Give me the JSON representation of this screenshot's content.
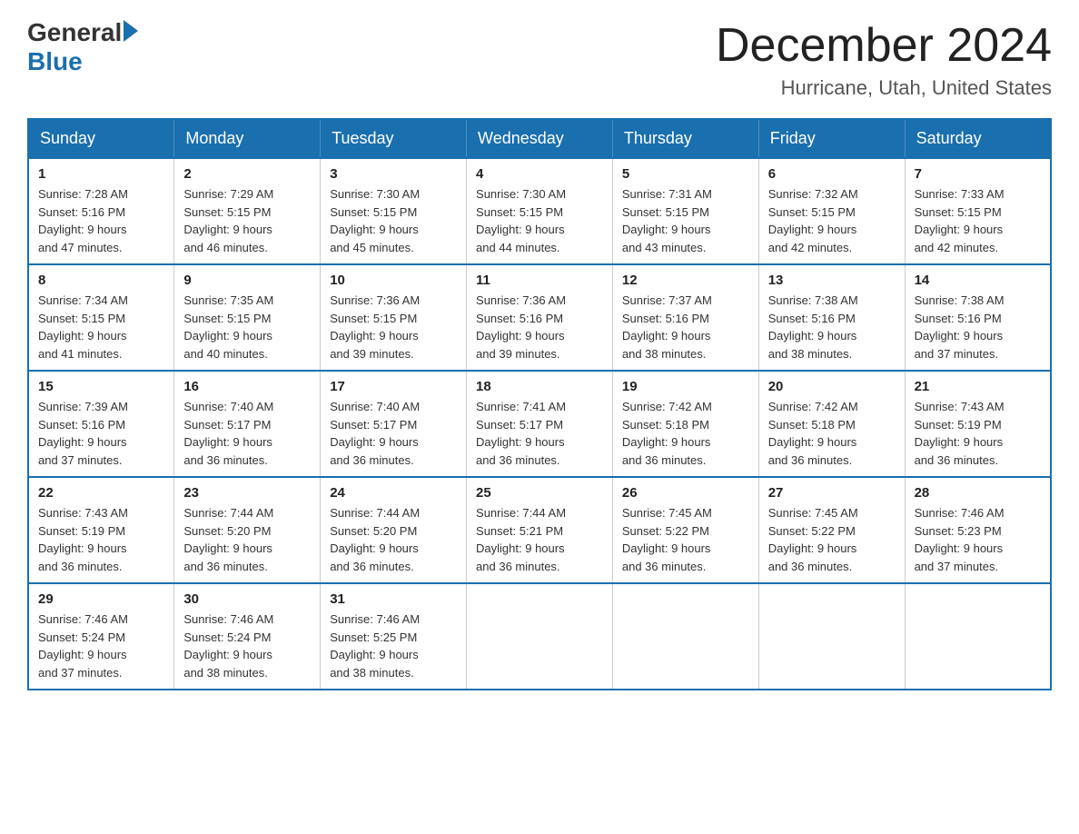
{
  "logo": {
    "general": "General",
    "blue": "Blue"
  },
  "title": "December 2024",
  "location": "Hurricane, Utah, United States",
  "weekdays": [
    "Sunday",
    "Monday",
    "Tuesday",
    "Wednesday",
    "Thursday",
    "Friday",
    "Saturday"
  ],
  "weeks": [
    [
      {
        "day": "1",
        "sunrise": "7:28 AM",
        "sunset": "5:16 PM",
        "daylight": "9 hours and 47 minutes."
      },
      {
        "day": "2",
        "sunrise": "7:29 AM",
        "sunset": "5:15 PM",
        "daylight": "9 hours and 46 minutes."
      },
      {
        "day": "3",
        "sunrise": "7:30 AM",
        "sunset": "5:15 PM",
        "daylight": "9 hours and 45 minutes."
      },
      {
        "day": "4",
        "sunrise": "7:30 AM",
        "sunset": "5:15 PM",
        "daylight": "9 hours and 44 minutes."
      },
      {
        "day": "5",
        "sunrise": "7:31 AM",
        "sunset": "5:15 PM",
        "daylight": "9 hours and 43 minutes."
      },
      {
        "day": "6",
        "sunrise": "7:32 AM",
        "sunset": "5:15 PM",
        "daylight": "9 hours and 42 minutes."
      },
      {
        "day": "7",
        "sunrise": "7:33 AM",
        "sunset": "5:15 PM",
        "daylight": "9 hours and 42 minutes."
      }
    ],
    [
      {
        "day": "8",
        "sunrise": "7:34 AM",
        "sunset": "5:15 PM",
        "daylight": "9 hours and 41 minutes."
      },
      {
        "day": "9",
        "sunrise": "7:35 AM",
        "sunset": "5:15 PM",
        "daylight": "9 hours and 40 minutes."
      },
      {
        "day": "10",
        "sunrise": "7:36 AM",
        "sunset": "5:15 PM",
        "daylight": "9 hours and 39 minutes."
      },
      {
        "day": "11",
        "sunrise": "7:36 AM",
        "sunset": "5:16 PM",
        "daylight": "9 hours and 39 minutes."
      },
      {
        "day": "12",
        "sunrise": "7:37 AM",
        "sunset": "5:16 PM",
        "daylight": "9 hours and 38 minutes."
      },
      {
        "day": "13",
        "sunrise": "7:38 AM",
        "sunset": "5:16 PM",
        "daylight": "9 hours and 38 minutes."
      },
      {
        "day": "14",
        "sunrise": "7:38 AM",
        "sunset": "5:16 PM",
        "daylight": "9 hours and 37 minutes."
      }
    ],
    [
      {
        "day": "15",
        "sunrise": "7:39 AM",
        "sunset": "5:16 PM",
        "daylight": "9 hours and 37 minutes."
      },
      {
        "day": "16",
        "sunrise": "7:40 AM",
        "sunset": "5:17 PM",
        "daylight": "9 hours and 36 minutes."
      },
      {
        "day": "17",
        "sunrise": "7:40 AM",
        "sunset": "5:17 PM",
        "daylight": "9 hours and 36 minutes."
      },
      {
        "day": "18",
        "sunrise": "7:41 AM",
        "sunset": "5:17 PM",
        "daylight": "9 hours and 36 minutes."
      },
      {
        "day": "19",
        "sunrise": "7:42 AM",
        "sunset": "5:18 PM",
        "daylight": "9 hours and 36 minutes."
      },
      {
        "day": "20",
        "sunrise": "7:42 AM",
        "sunset": "5:18 PM",
        "daylight": "9 hours and 36 minutes."
      },
      {
        "day": "21",
        "sunrise": "7:43 AM",
        "sunset": "5:19 PM",
        "daylight": "9 hours and 36 minutes."
      }
    ],
    [
      {
        "day": "22",
        "sunrise": "7:43 AM",
        "sunset": "5:19 PM",
        "daylight": "9 hours and 36 minutes."
      },
      {
        "day": "23",
        "sunrise": "7:44 AM",
        "sunset": "5:20 PM",
        "daylight": "9 hours and 36 minutes."
      },
      {
        "day": "24",
        "sunrise": "7:44 AM",
        "sunset": "5:20 PM",
        "daylight": "9 hours and 36 minutes."
      },
      {
        "day": "25",
        "sunrise": "7:44 AM",
        "sunset": "5:21 PM",
        "daylight": "9 hours and 36 minutes."
      },
      {
        "day": "26",
        "sunrise": "7:45 AM",
        "sunset": "5:22 PM",
        "daylight": "9 hours and 36 minutes."
      },
      {
        "day": "27",
        "sunrise": "7:45 AM",
        "sunset": "5:22 PM",
        "daylight": "9 hours and 36 minutes."
      },
      {
        "day": "28",
        "sunrise": "7:46 AM",
        "sunset": "5:23 PM",
        "daylight": "9 hours and 37 minutes."
      }
    ],
    [
      {
        "day": "29",
        "sunrise": "7:46 AM",
        "sunset": "5:24 PM",
        "daylight": "9 hours and 37 minutes."
      },
      {
        "day": "30",
        "sunrise": "7:46 AM",
        "sunset": "5:24 PM",
        "daylight": "9 hours and 38 minutes."
      },
      {
        "day": "31",
        "sunrise": "7:46 AM",
        "sunset": "5:25 PM",
        "daylight": "9 hours and 38 minutes."
      },
      null,
      null,
      null,
      null
    ]
  ],
  "labels": {
    "sunrise": "Sunrise:",
    "sunset": "Sunset:",
    "daylight": "Daylight:"
  }
}
